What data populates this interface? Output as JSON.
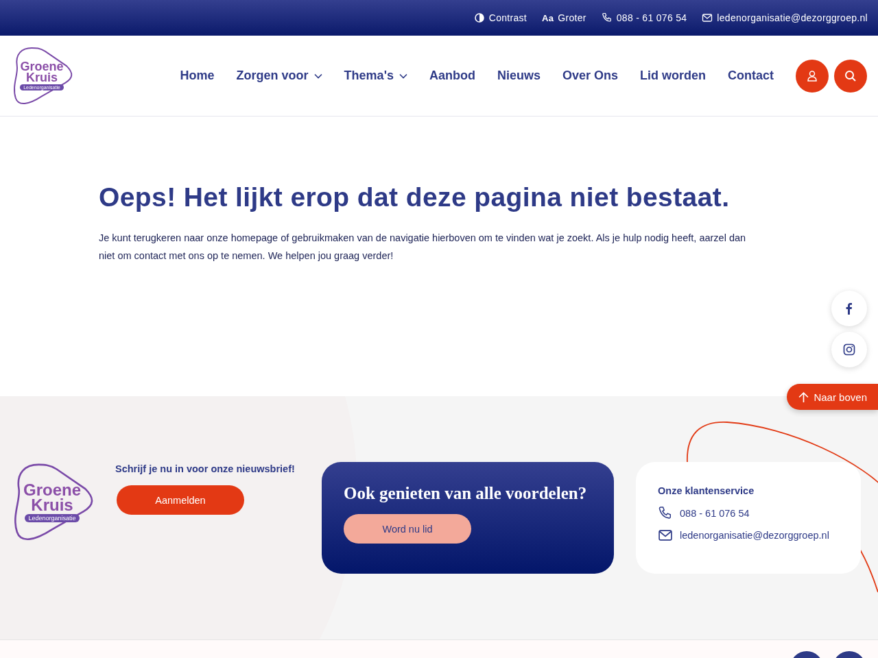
{
  "top_bar": {
    "items": [
      {
        "kind": "contrast",
        "label": "Contrast"
      },
      {
        "kind": "font",
        "icon_text": "Aa",
        "label": "Groter"
      },
      {
        "kind": "phone",
        "label": "088 - 61 076 54"
      },
      {
        "kind": "mail",
        "label": "ledenorganisatie@dezorggroep.nl"
      }
    ]
  },
  "header": {
    "logo": {
      "line_1": "Groene",
      "line_2": "Kruis",
      "tagline": "Ledenorganisatie"
    },
    "nav": [
      {
        "label": "Home",
        "dropdown": false
      },
      {
        "label": "Zorgen voor",
        "dropdown": true
      },
      {
        "label": "Thema's",
        "dropdown": true
      },
      {
        "label": "Aanbod",
        "dropdown": false
      },
      {
        "label": "Nieuws",
        "dropdown": false
      },
      {
        "label": "Over Ons",
        "dropdown": false
      },
      {
        "label": "Lid worden",
        "dropdown": false
      },
      {
        "label": "Contact",
        "dropdown": false
      }
    ]
  },
  "main": {
    "title": "Oeps! Het lijkt erop dat deze pagina niet bestaat.",
    "text": "Je kunt terugkeren naar onze homepage of gebruikmaken van de navigatie hierboven om te vinden wat je zoekt. Als je hulp nodig heeft, aarzel dan niet om contact met ons op te nemen. We helpen jou graag verder!"
  },
  "back_to_top": {
    "label": "Naar boven"
  },
  "footer": {
    "logo": {
      "line_1": "Groene",
      "line_2": "Kruis",
      "tagline": "Ledenorganisatie"
    },
    "newsletter": {
      "title": "Schrijf je nu in voor onze nieuwsbrief!",
      "button": "Aanmelden"
    },
    "promo": {
      "title": "Ook genieten van alle voordelen?",
      "button": "Word nu lid"
    },
    "service": {
      "title": "Onze klantenservice",
      "items": [
        {
          "kind": "phone",
          "label": "088 - 61 076 54"
        },
        {
          "kind": "mail",
          "label": "ledenorganisatie@dezorggroep.nl"
        }
      ]
    }
  }
}
